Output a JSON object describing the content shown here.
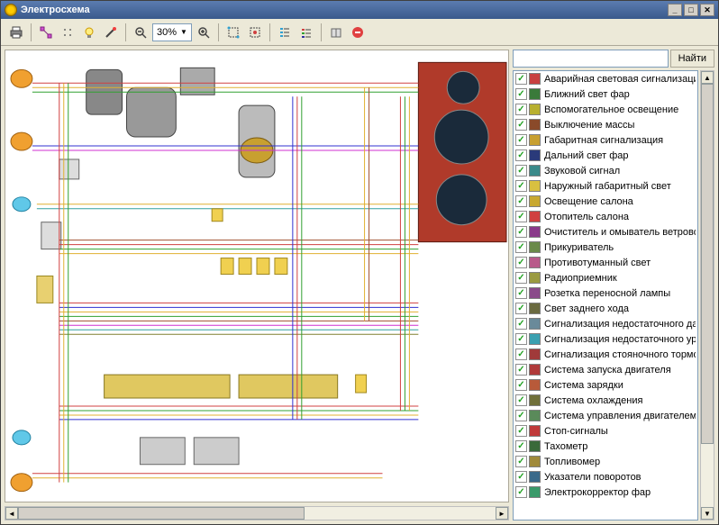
{
  "title": "Электросхема",
  "toolbar": {
    "zoom_value": "30%"
  },
  "search": {
    "placeholder": "",
    "find_label": "Найти"
  },
  "circuits": [
    {
      "color": "#c84040",
      "label": "Аварийная световая сигнализация",
      "checked": true
    },
    {
      "color": "#3a7a3a",
      "label": "Ближний свет фар",
      "checked": true
    },
    {
      "color": "#b8b030",
      "label": "Вспомогательное освещение",
      "checked": true
    },
    {
      "color": "#8a4a2a",
      "label": "Выключение массы",
      "checked": true
    },
    {
      "color": "#c8a030",
      "label": "Габаритная сигнализация",
      "checked": true
    },
    {
      "color": "#2a3a7a",
      "label": "Дальний свет фар",
      "checked": true
    },
    {
      "color": "#3a8a8a",
      "label": "Звуковой сигнал",
      "checked": true
    },
    {
      "color": "#d8c040",
      "label": "Наружный габаритный свет",
      "checked": true
    },
    {
      "color": "#c8a830",
      "label": "Освещение салона",
      "checked": true
    },
    {
      "color": "#d04040",
      "label": "Отопитель салона",
      "checked": true
    },
    {
      "color": "#8a3a8a",
      "label": "Очиститель и омыватель ветрового стекл",
      "checked": true
    },
    {
      "color": "#6a8a4a",
      "label": "Прикуриватель",
      "checked": true
    },
    {
      "color": "#b85a8a",
      "label": "Противотуманный свет",
      "checked": true
    },
    {
      "color": "#9a9a40",
      "label": "Радиоприемник",
      "checked": true
    },
    {
      "color": "#8a4a8a",
      "label": "Розетка переносной лампы",
      "checked": true
    },
    {
      "color": "#6a6a40",
      "label": "Свет заднего хода",
      "checked": true
    },
    {
      "color": "#6a8a9a",
      "label": "Сигнализация недостаточного давления м",
      "checked": true
    },
    {
      "color": "#3aa0b0",
      "label": "Сигнализация недостаточного уровня тор",
      "checked": true
    },
    {
      "color": "#a03a3a",
      "label": "Сигнализация стояночного тормоза",
      "checked": true
    },
    {
      "color": "#b03a3a",
      "label": "Система запуска двигателя",
      "checked": true
    },
    {
      "color": "#b85a3a",
      "label": "Система зарядки",
      "checked": true
    },
    {
      "color": "#70703a",
      "label": "Система охлаждения",
      "checked": true
    },
    {
      "color": "#5a8a5a",
      "label": "Система управления двигателем",
      "checked": true
    },
    {
      "color": "#c03a3a",
      "label": "Стоп-сигналы",
      "checked": true
    },
    {
      "color": "#3a6a3a",
      "label": "Тахометр",
      "checked": true
    },
    {
      "color": "#a08a3a",
      "label": "Топливомер",
      "checked": true
    },
    {
      "color": "#3a6a8a",
      "label": "Указатели поворотов",
      "checked": true
    },
    {
      "color": "#3a9a6a",
      "label": "Электрокорректор фар",
      "checked": true
    }
  ]
}
